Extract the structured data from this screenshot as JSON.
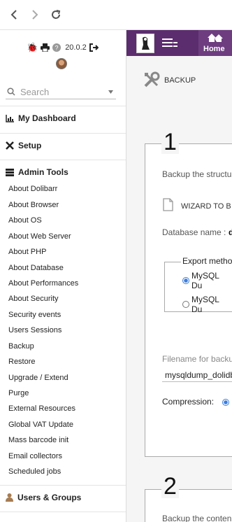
{
  "browser": {
    "back_icon": "arrow-left-icon",
    "forward_icon": "arrow-right-icon",
    "reload_icon": "reload-icon"
  },
  "topbar": {
    "home_label": "Home",
    "bg": "#5c2d6e"
  },
  "user": {
    "version": "20.0.2"
  },
  "search": {
    "placeholder": "Search"
  },
  "menu": {
    "my_dashboard": "My Dashboard",
    "setup": "Setup",
    "admin_tools": "Admin Tools",
    "items": [
      "About Dolibarr",
      "About Browser",
      "About OS",
      "About Web Server",
      "About PHP",
      "About Database",
      "About Performances",
      "About Security",
      "Security events",
      "Users Sessions",
      "Backup",
      "Restore",
      "Upgrade / Extend",
      "Purge",
      "External Resources",
      "Global VAT Update",
      "Mass barcode init",
      "Email collectors",
      "Scheduled jobs"
    ],
    "users_groups": "Users & Groups"
  },
  "page": {
    "title": "BACKUP",
    "step1": {
      "number": "1",
      "intro": "Backup the structu",
      "wizard": "WIZARD TO B",
      "db_label": "Database name :",
      "db_value": "d",
      "export_legend": "Export metho",
      "opt1": "MySQL Du",
      "opt2": "MySQL Du",
      "filename_label": "Filename for backu",
      "filename_value": "mysqldump_dolidb",
      "compression_label": "Compression:"
    },
    "step2": {
      "number": "2",
      "intro": "Backup the conten"
    }
  }
}
